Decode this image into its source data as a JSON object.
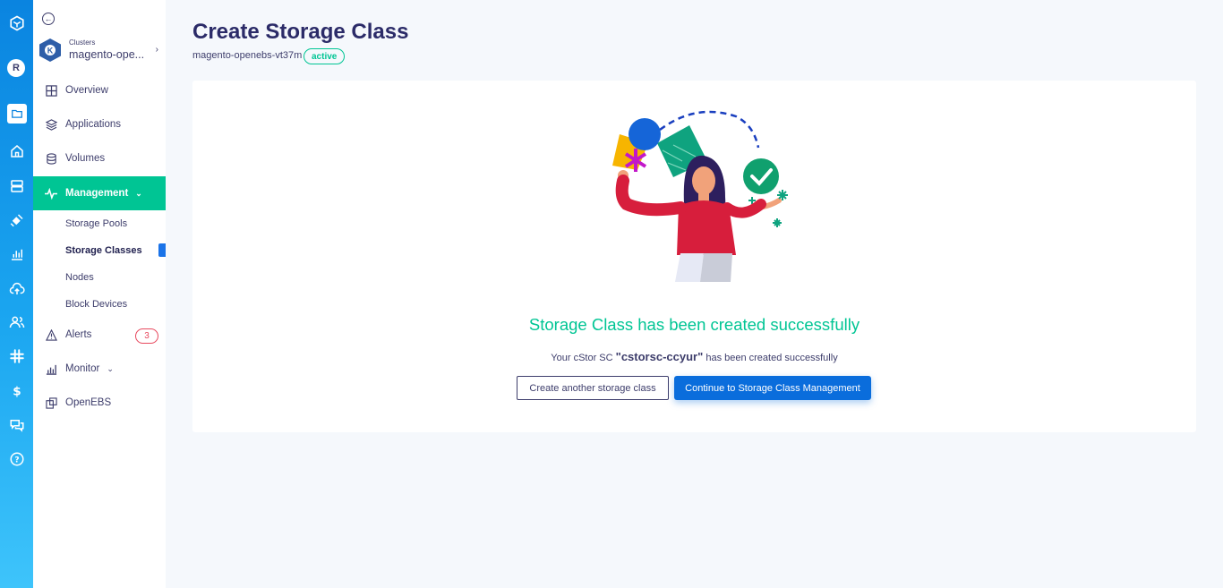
{
  "rail": {
    "avatar_initial": "R",
    "icons": [
      "app-logo-icon",
      "folder-icon",
      "home-icon",
      "server-icon",
      "satellite-icon",
      "bar-chart-icon",
      "cloud-upload-icon",
      "users-icon",
      "slack-icon",
      "dollar-icon",
      "chat-icon",
      "help-icon"
    ]
  },
  "sidebar": {
    "cluster_caption": "Clusters",
    "cluster_name": "magento-ope...",
    "items": [
      {
        "label": "Overview",
        "icon": "grid-icon"
      },
      {
        "label": "Applications",
        "icon": "layers-icon"
      },
      {
        "label": "Volumes",
        "icon": "database-icon"
      },
      {
        "label": "Management",
        "icon": "pulse-icon"
      },
      {
        "label": "Alerts",
        "icon": "warning-icon"
      },
      {
        "label": "Monitor",
        "icon": "chart-icon"
      },
      {
        "label": "OpenEBS",
        "icon": "openebs-icon"
      }
    ],
    "management_sub": [
      "Storage Pools",
      "Storage Classes",
      "Nodes",
      "Block Devices"
    ],
    "alerts_count": "3"
  },
  "header": {
    "title": "Create Storage Class",
    "cluster": "magento-openebs-vt37m",
    "status": "active"
  },
  "result": {
    "title": "Storage Class has been created successfully",
    "msg_prefix": "Your cStor SC",
    "sc_name": "\"cstorsc-ccyur\"",
    "msg_suffix": "has been created successfully",
    "secondary_button": "Create another storage class",
    "primary_button": "Continue to Storage Class Management"
  },
  "colors": {
    "accent_green": "#00c594",
    "primary_blue": "#0a6ddc",
    "rail_gradient_top": "#0a84e0",
    "text_dark": "#3d3d6b"
  }
}
